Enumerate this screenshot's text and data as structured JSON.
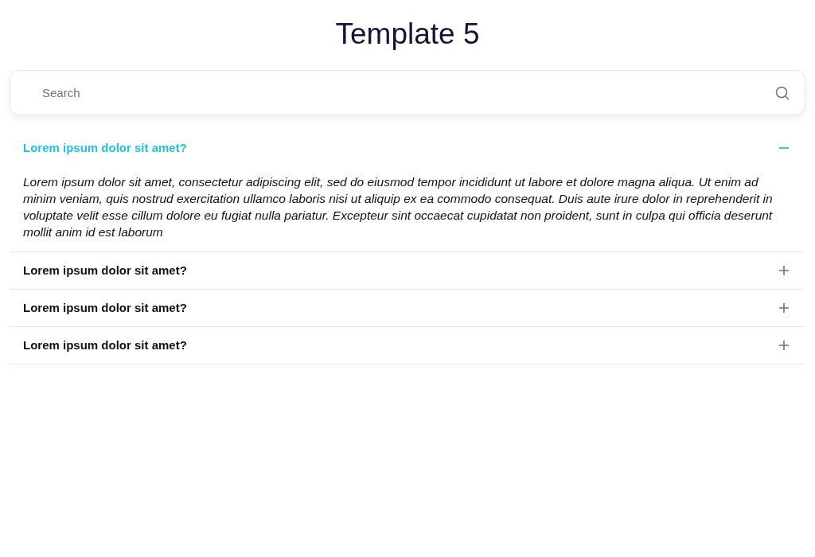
{
  "title": "Template 5",
  "search": {
    "placeholder": "Search"
  },
  "faq": [
    {
      "question": "Lorem ipsum dolor sit amet?",
      "expanded": true,
      "answer": "Lorem ipsum dolor sit amet, consectetur adipiscing elit, sed do eiusmod tempor incididunt ut labore et dolore magna aliqua. Ut enim ad minim veniam, quis nostrud exercitation ullamco laboris nisi ut aliquip ex ea commodo consequat. Duis aute irure dolor in reprehenderit in voluptate velit esse cillum dolore eu fugiat nulla pariatur. Excepteur sint occaecat cupidatat non proident, sunt in culpa qui officia deserunt mollit anim id est laborum"
    },
    {
      "question": "Lorem ipsum dolor sit amet?",
      "expanded": false
    },
    {
      "question": "Lorem ipsum dolor sit amet?",
      "expanded": false
    },
    {
      "question": "Lorem ipsum dolor sit amet?",
      "expanded": false
    }
  ]
}
